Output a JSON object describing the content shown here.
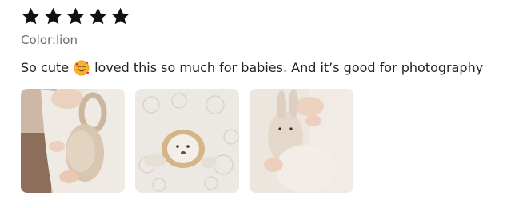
{
  "review": {
    "rating": 5,
    "rating_max": 5,
    "variant": "Color:lion",
    "text_before_emoji": "So cute",
    "emoji": "smiling-face-with-hearts-emoji",
    "text_after_emoji": "loved this so much for babies. And it’s good for photography",
    "photos": [
      {
        "name": "review-photo-1",
        "subject": "baby holding crochet bunny rattle"
      },
      {
        "name": "review-photo-2",
        "subject": "crochet lion toy on lace blanket"
      },
      {
        "name": "review-photo-3",
        "subject": "baby hands holding crochet bunny"
      }
    ]
  },
  "colors": {
    "star": "#111111",
    "variant_text": "#6b6b6b",
    "body_text": "#222222"
  }
}
